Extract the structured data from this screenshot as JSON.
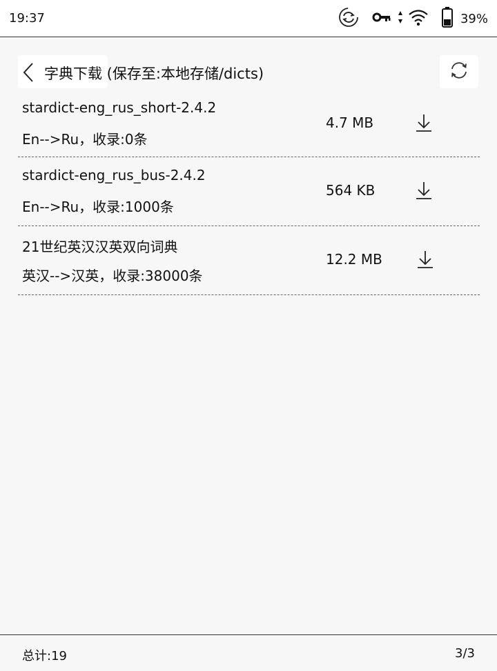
{
  "status_bar": {
    "time": "19:37",
    "icons": [
      "sync-icon",
      "key-icon",
      "data-arrows-icon",
      "wifi-icon",
      "battery-icon"
    ],
    "battery_percent": "39%"
  },
  "header": {
    "back_icon": "chevron-left-icon",
    "title": "字典下载 (保存至:本地存储/dicts)",
    "refresh_icon": "refresh-icon"
  },
  "dictionaries": [
    {
      "name": "stardict-eng_rus_short-2.4.2",
      "desc": "En-->Ru，收录:0条",
      "size": "4.7 MB"
    },
    {
      "name": "stardict-eng_rus_bus-2.4.2",
      "desc": "En-->Ru，收录:1000条",
      "size": "564 KB"
    },
    {
      "name": "21世纪英汉汉英双向词典",
      "desc": "英汉-->汉英，收录:38000条",
      "size": "12.2 MB"
    }
  ],
  "footer": {
    "total": "总计:19",
    "page": "3/3"
  },
  "colors": {
    "background": "#f7f7f7",
    "text": "#111111",
    "divider": "#666666"
  }
}
